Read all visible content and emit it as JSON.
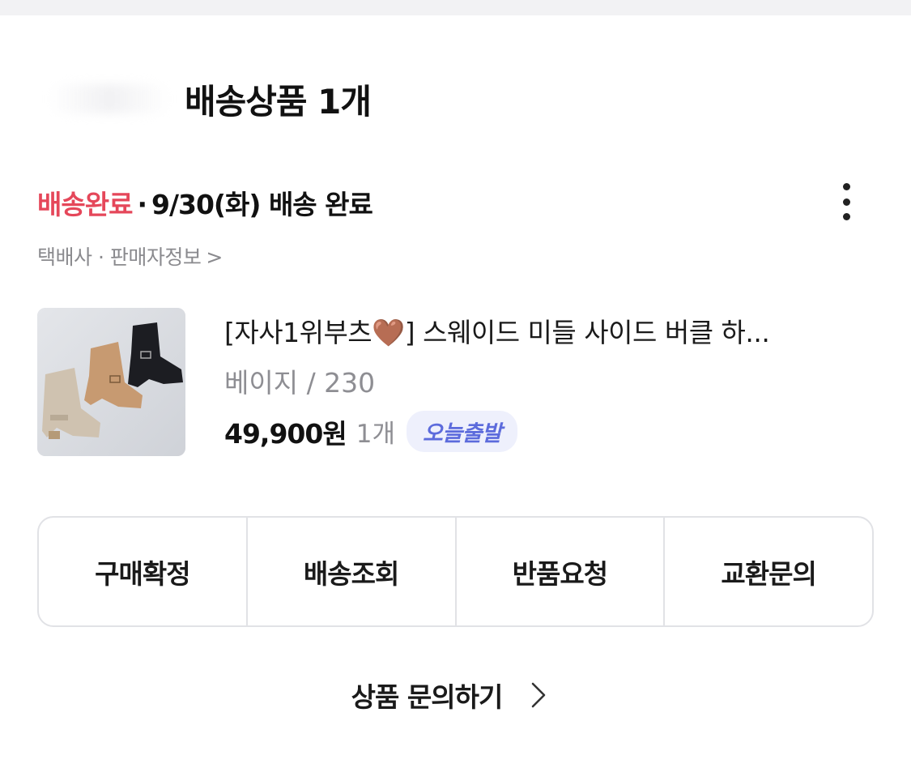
{
  "header": {
    "title": "배송상품 1개"
  },
  "shipment": {
    "status": "배송완료",
    "separator": "·",
    "date_text": "9/30(화) 배송 완료",
    "sub_info": "택배사 · 판매자정보",
    "sub_info_arrow": ">"
  },
  "product": {
    "name": "[자사1위부츠🤎] 스웨이드 미들 사이드 버클 하...",
    "option": "베이지 / 230",
    "price": "49,900원",
    "quantity": "1개",
    "badge": "오늘출발"
  },
  "actions": [
    {
      "label": "구매확정"
    },
    {
      "label": "배송조회"
    },
    {
      "label": "반품요청"
    },
    {
      "label": "교환문의"
    }
  ],
  "footer": {
    "inquiry_label": "상품 문의하기"
  },
  "colors": {
    "status_accent": "#e5475a",
    "badge_text": "#5c6bdc",
    "badge_bg": "#eef0fc",
    "muted_text": "#8e8e93"
  },
  "icons": [
    "more-vertical-icon",
    "chevron-right-icon"
  ]
}
